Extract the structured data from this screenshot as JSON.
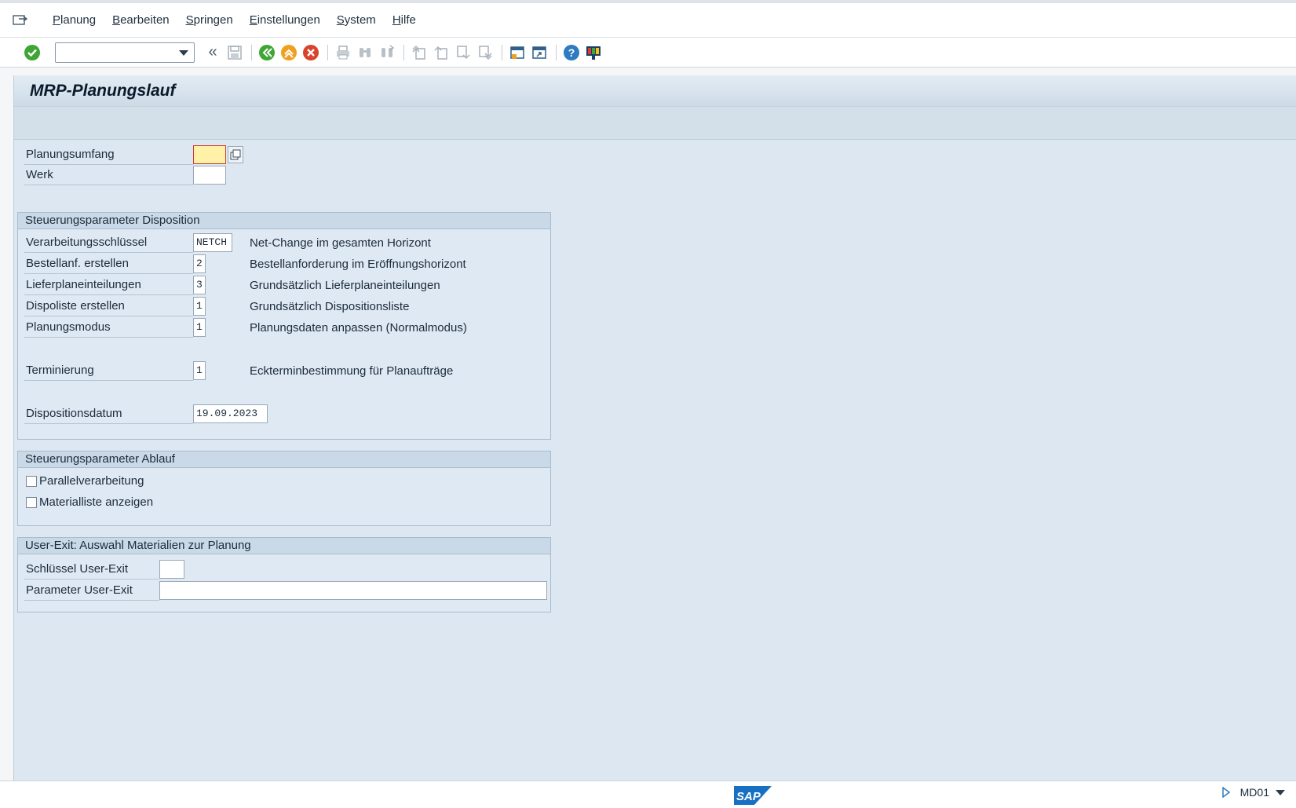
{
  "menu": {
    "items": [
      "Planung",
      "Bearbeiten",
      "Springen",
      "Einstellungen",
      "System",
      "Hilfe"
    ]
  },
  "toolbar": {
    "command_field_value": "",
    "icons": [
      "enter-icon",
      "back-double-chevron-icon",
      "save-icon",
      "back-icon",
      "exit-icon",
      "cancel-icon",
      "print-icon",
      "find-icon",
      "find-next-icon",
      "first-page-icon",
      "previous-page-icon",
      "next-page-icon",
      "last-page-icon",
      "create-session-icon",
      "shortcut-icon",
      "help-icon",
      "customize-layout-icon"
    ]
  },
  "title": "MRP-Planungslauf",
  "top_fields": [
    {
      "label": "Planungsumfang",
      "value": ""
    },
    {
      "label": "Werk",
      "value": ""
    }
  ],
  "group_disposition": {
    "title": "Steuerungsparameter Disposition",
    "rows": [
      {
        "label": "Verarbeitungsschlüssel",
        "value": "NETCH",
        "desc": "Net-Change im gesamten Horizont"
      },
      {
        "label": "Bestellanf. erstellen",
        "value": "2",
        "desc": "Bestellanforderung im Eröffnungshorizont"
      },
      {
        "label": "Lieferplaneinteilungen",
        "value": "3",
        "desc": "Grundsätzlich Lieferplaneinteilungen"
      },
      {
        "label": "Dispoliste erstellen",
        "value": "1",
        "desc": "Grundsätzlich Dispositionsliste"
      },
      {
        "label": "Planungsmodus",
        "value": "1",
        "desc": "Planungsdaten anpassen (Normalmodus)"
      },
      {
        "label": "Terminierung",
        "value": "1",
        "desc": "Eckterminbestimmung für Planaufträge"
      },
      {
        "label": "Dispositionsdatum",
        "value": "19.09.2023",
        "desc": ""
      }
    ]
  },
  "group_ablauf": {
    "title": "Steuerungsparameter Ablauf",
    "checkboxes": [
      {
        "label": "Parallelverarbeitung",
        "checked": false
      },
      {
        "label": "Materialliste anzeigen",
        "checked": false
      }
    ]
  },
  "group_userexit": {
    "title": "User-Exit: Auswahl Materialien zur Planung",
    "rows": [
      {
        "label": "Schlüssel User-Exit",
        "value": ""
      },
      {
        "label": "Parameter User-Exit",
        "value": ""
      }
    ]
  },
  "status": {
    "logo_text": "SAP",
    "transaction": "MD01"
  },
  "colors": {
    "accent": "#0a6ed1",
    "background": "#dce7f1",
    "focus_field": "#fff2a8"
  }
}
